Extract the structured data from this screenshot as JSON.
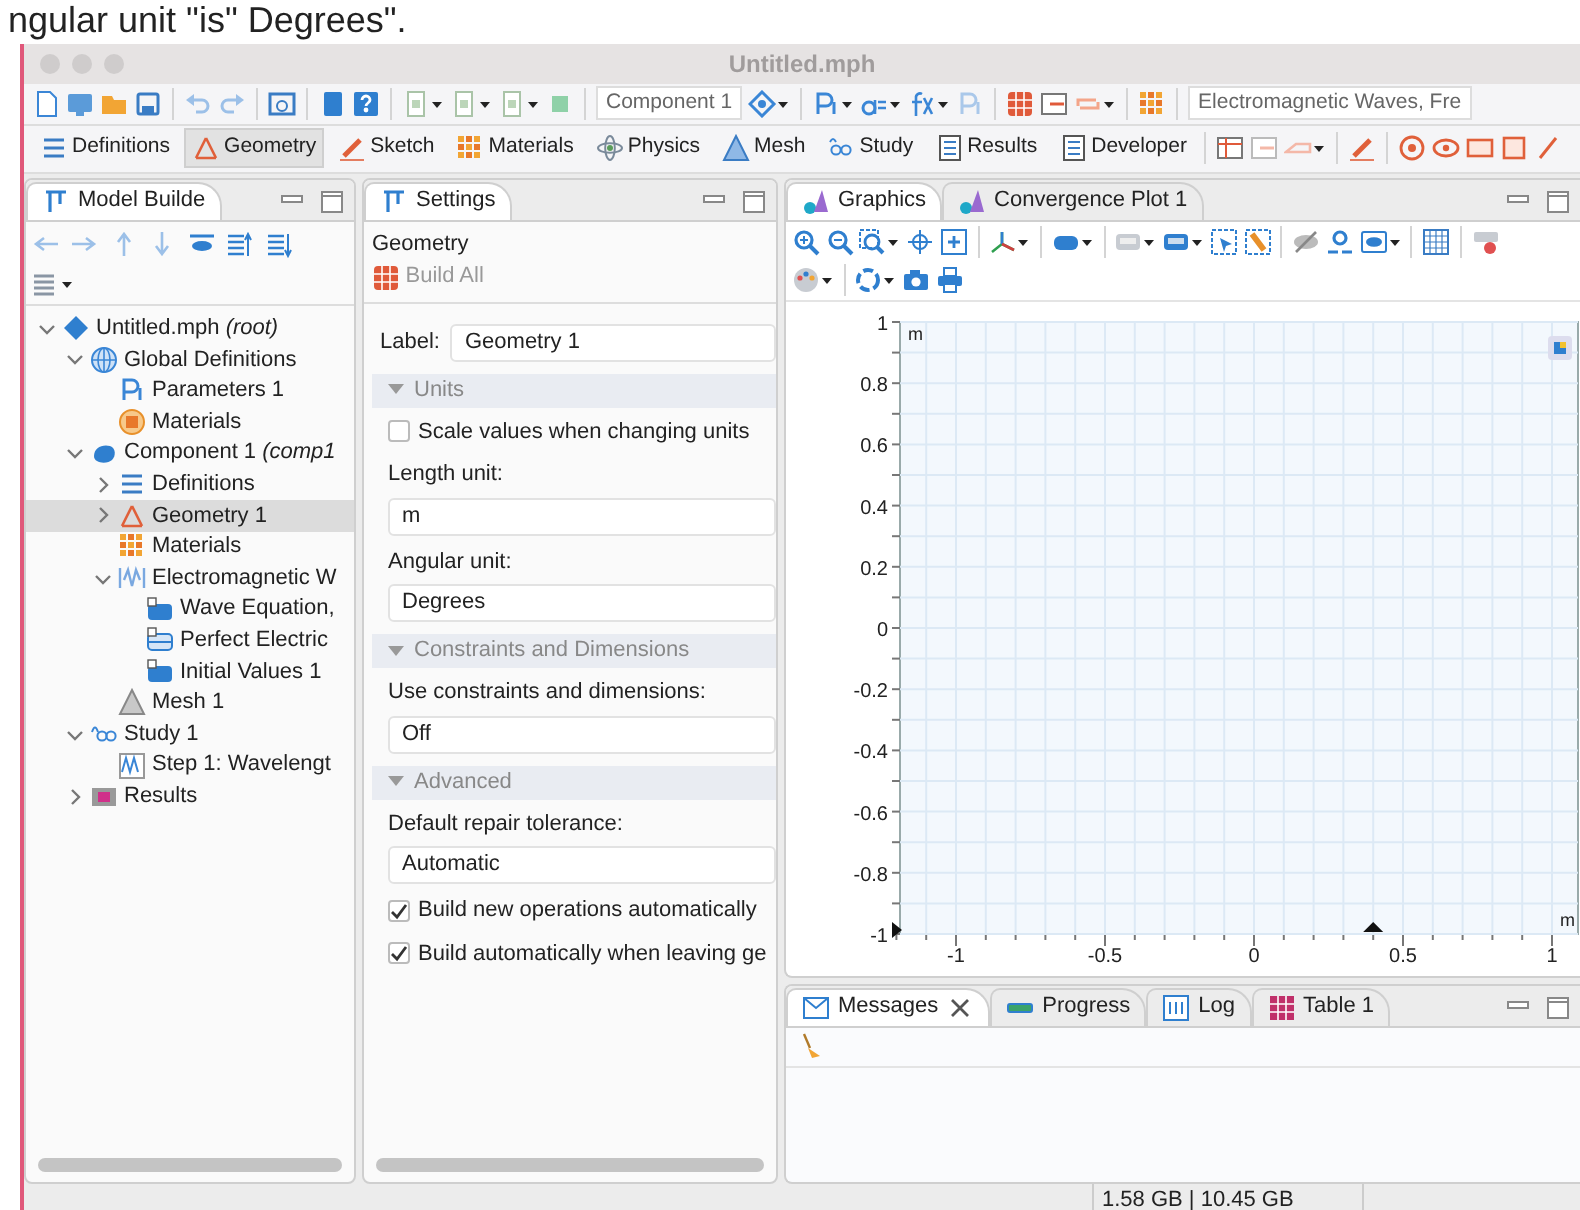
{
  "caption": "ngular unit \"is\" Degrees\".",
  "window": {
    "title": "Untitled.mph"
  },
  "main_toolbar": {
    "component": "Component 1",
    "physics": "Electromagnetic Waves, Fre"
  },
  "ribbon_tabs": [
    {
      "label": "Definitions",
      "selected": false
    },
    {
      "label": "Geometry",
      "selected": true
    },
    {
      "label": "Sketch",
      "selected": false
    },
    {
      "label": "Materials",
      "selected": false
    },
    {
      "label": "Physics",
      "selected": false
    },
    {
      "label": "Mesh",
      "selected": false
    },
    {
      "label": "Study",
      "selected": false
    },
    {
      "label": "Results",
      "selected": false
    },
    {
      "label": "Developer",
      "selected": false
    }
  ],
  "model_builder": {
    "title": "Model Builde",
    "tree": [
      {
        "label": "Untitled.mph *(root)*",
        "expanded": true,
        "selected": false,
        "children": [
          {
            "label": "Global Definitions",
            "expanded": true,
            "selected": false,
            "children": [
              {
                "label": "Parameters 1",
                "selected": false
              },
              {
                "label": "Materials",
                "selected": false
              }
            ]
          },
          {
            "label": "Component 1 *(comp1*",
            "expanded": true,
            "selected": false,
            "children": [
              {
                "label": "Definitions",
                "expanded": false,
                "selected": false
              },
              {
                "label": "Geometry 1",
                "expanded": false,
                "selected": true
              },
              {
                "label": "Materials",
                "selected": false
              },
              {
                "label": "Electromagnetic W",
                "expanded": true,
                "selected": false,
                "children": [
                  {
                    "label": "Wave Equation,",
                    "selected": false
                  },
                  {
                    "label": "Perfect Electric",
                    "selected": false
                  },
                  {
                    "label": "Initial Values 1",
                    "selected": false
                  }
                ]
              },
              {
                "label": "Mesh 1",
                "selected": false
              }
            ]
          },
          {
            "label": "Study 1",
            "expanded": true,
            "selected": false,
            "children": [
              {
                "label": "Step 1: Wavelengt",
                "selected": false
              }
            ]
          },
          {
            "label": "Results",
            "expanded": false,
            "selected": false
          }
        ]
      }
    ]
  },
  "settings": {
    "title": "Settings",
    "node": "Geometry",
    "build_button": "Build All",
    "label_caption": "Label:",
    "label_value": "Geometry 1",
    "sections": [
      {
        "title": "Units",
        "expanded": true,
        "fields": [
          {
            "kind": "checkbox",
            "label": "Scale values when changing units",
            "checked": false
          },
          {
            "kind": "select",
            "label": "Length unit:",
            "value": "m"
          },
          {
            "kind": "select",
            "label": "Angular unit:",
            "value": "Degrees"
          }
        ]
      },
      {
        "title": "Constraints and Dimensions",
        "expanded": true,
        "fields": [
          {
            "kind": "select",
            "label": "Use constraints and dimensions:",
            "value": "Off"
          }
        ]
      },
      {
        "title": "Advanced",
        "expanded": true,
        "fields": [
          {
            "kind": "select",
            "label": "Default repair tolerance:",
            "value": "Automatic"
          },
          {
            "kind": "checkbox",
            "label": "Build new operations automatically",
            "checked": true
          },
          {
            "kind": "checkbox",
            "label": "Build automatically when leaving ge",
            "checked": true
          }
        ]
      }
    ]
  },
  "graphics": {
    "tabs": [
      {
        "label": "Graphics",
        "selected": true
      },
      {
        "label": "Convergence Plot 1",
        "selected": false
      }
    ],
    "y_labels": [
      "1",
      "0.8",
      "0.6",
      "0.4",
      "0.2",
      "0",
      "-0.2",
      "-0.4",
      "-0.6",
      "-0.8",
      "-1"
    ],
    "x_labels": [
      "-1",
      "-0.5",
      "0",
      "0.5",
      "1"
    ],
    "unit_top": "m",
    "unit_right": "m"
  },
  "messages": {
    "tabs": [
      {
        "label": "Messages",
        "selected": true
      },
      {
        "label": "Progress",
        "selected": false
      },
      {
        "label": "Log",
        "selected": false
      },
      {
        "label": "Table 1",
        "selected": false
      }
    ]
  },
  "status_bar": {
    "memory": "1.58 GB | 10.45 GB"
  }
}
